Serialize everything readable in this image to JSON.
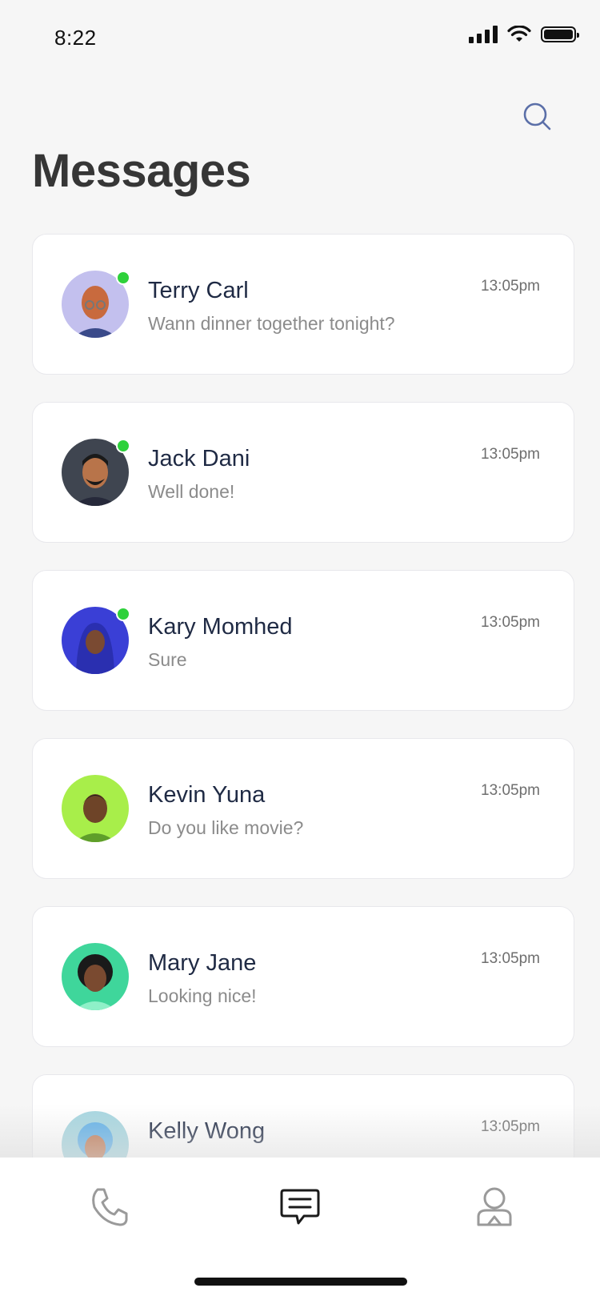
{
  "status_bar": {
    "time": "8:22",
    "icons": [
      "cellular-signal-icon",
      "wifi-icon",
      "battery-icon"
    ]
  },
  "header": {
    "title": "Messages",
    "search_icon": "search-icon"
  },
  "colors": {
    "background": "#f6f6f6",
    "card": "#ffffff",
    "title": "#363636",
    "name": "#1f2a44",
    "preview": "#8b8b8b",
    "online": "#2ed13b",
    "inactive_icon": "#9a9a9a",
    "active_icon": "#1a1a1a"
  },
  "conversations": [
    {
      "name": "Terry Carl",
      "preview": "Wann dinner together tonight?",
      "time": "13:05pm",
      "online": true,
      "avatar_bg": "#c3c0ee"
    },
    {
      "name": "Jack Dani",
      "preview": "Well done!",
      "time": "13:05pm",
      "online": true,
      "avatar_bg": "#3f4550"
    },
    {
      "name": "Kary Momhed",
      "preview": "Sure",
      "time": "13:05pm",
      "online": true,
      "avatar_bg": "#3a3fd6"
    },
    {
      "name": "Kevin Yuna",
      "preview": "Do you like movie?",
      "time": "13:05pm",
      "online": false,
      "avatar_bg": "#a8ee4a"
    },
    {
      "name": "Mary Jane",
      "preview": "Looking nice!",
      "time": "13:05pm",
      "online": false,
      "avatar_bg": "#3fd69b"
    },
    {
      "name": "Kelly Wong",
      "preview": "",
      "time": "13:05pm",
      "online": false,
      "avatar_bg": "#a6d6e0"
    }
  ],
  "tab_bar": {
    "tabs": [
      {
        "id": "calls",
        "icon": "phone-icon",
        "active": false
      },
      {
        "id": "messages",
        "icon": "chat-icon",
        "active": true
      },
      {
        "id": "profile",
        "icon": "profile-icon",
        "active": false
      }
    ]
  }
}
